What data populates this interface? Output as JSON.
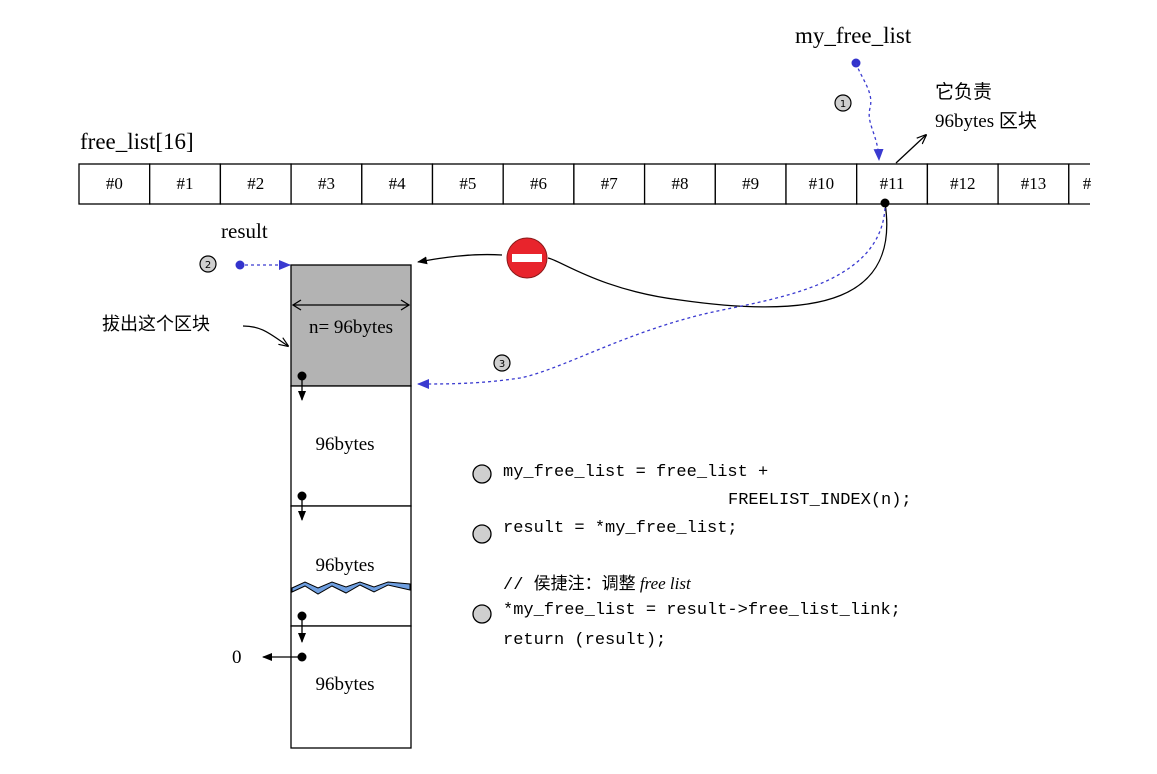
{
  "labels": {
    "my_free_list": "my_free_list",
    "free_list_title": "free_list[16]",
    "result": "result",
    "responsible_line1": "它负责",
    "responsible_line2": "96bytes 区块",
    "extract_block": "拔出这个区块",
    "null_value": "0",
    "block_n": "n= 96bytes",
    "block_2": "96bytes",
    "block_3": "96bytes",
    "block_4": "96bytes"
  },
  "array_cells": [
    "#0",
    "#1",
    "#2",
    "#3",
    "#4",
    "#5",
    "#6",
    "#7",
    "#8",
    "#9",
    "#10",
    "#11",
    "#12",
    "#13",
    "#"
  ],
  "steps": {
    "step1": "1",
    "step2": "2",
    "step3": "3"
  },
  "code": {
    "line1": "my_free_list = free_list +",
    "line2": "FREELIST_INDEX(n);",
    "line3": "result = *my_free_list;",
    "comment_prefix": "// 侯捷注：调整",
    "comment_italic": "free list",
    "line4": "*my_free_list = result->free_list_link;",
    "line5": "return (result);"
  },
  "colors": {
    "dashed_arrow": "#3a3ad0",
    "dot_blue": "#3333cc",
    "stop_sign": "#e8242c",
    "block_fill": "#b3b3b3",
    "wave_fill": "#6f9fe0"
  },
  "icons": {
    "stop": "no-entry-icon"
  }
}
